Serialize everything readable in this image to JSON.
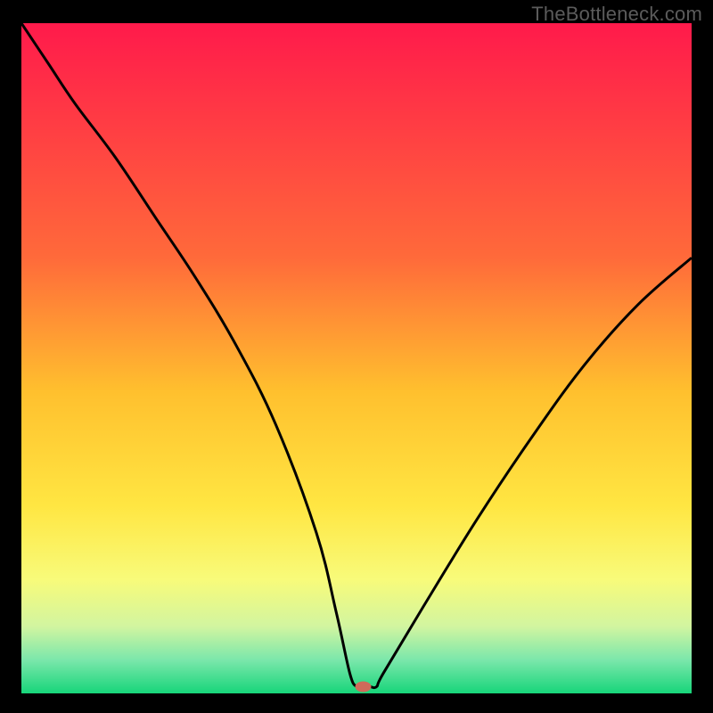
{
  "watermark": "TheBottleneck.com",
  "chart_data": {
    "type": "line",
    "title": "",
    "xlabel": "",
    "ylabel": "",
    "xlim": [
      0,
      100
    ],
    "ylim": [
      0,
      100
    ],
    "background_gradient": {
      "stops": [
        {
          "offset": 0,
          "color": "#ff1a4b"
        },
        {
          "offset": 35,
          "color": "#ff6a3a"
        },
        {
          "offset": 55,
          "color": "#ffc02e"
        },
        {
          "offset": 72,
          "color": "#ffe642"
        },
        {
          "offset": 83,
          "color": "#f8fb7a"
        },
        {
          "offset": 90,
          "color": "#d2f5a0"
        },
        {
          "offset": 95,
          "color": "#7be7ab"
        },
        {
          "offset": 100,
          "color": "#17d57a"
        }
      ]
    },
    "series": [
      {
        "name": "bottleneck-curve",
        "color": "#000000",
        "x": [
          0,
          4,
          8,
          14,
          20,
          26,
          32,
          38,
          44,
          47,
          49,
          50,
          51,
          52,
          53,
          54,
          60,
          68,
          76,
          84,
          92,
          100
        ],
        "values": [
          100,
          94,
          88,
          80,
          71,
          62,
          52,
          40,
          24,
          12,
          3,
          1,
          1,
          1,
          1,
          3,
          13,
          26,
          38,
          49,
          58,
          65
        ]
      }
    ],
    "marker": {
      "name": "optimal-point",
      "x": 51,
      "y": 1,
      "color": "#d06a5a",
      "rx": 9,
      "ry": 6
    }
  }
}
